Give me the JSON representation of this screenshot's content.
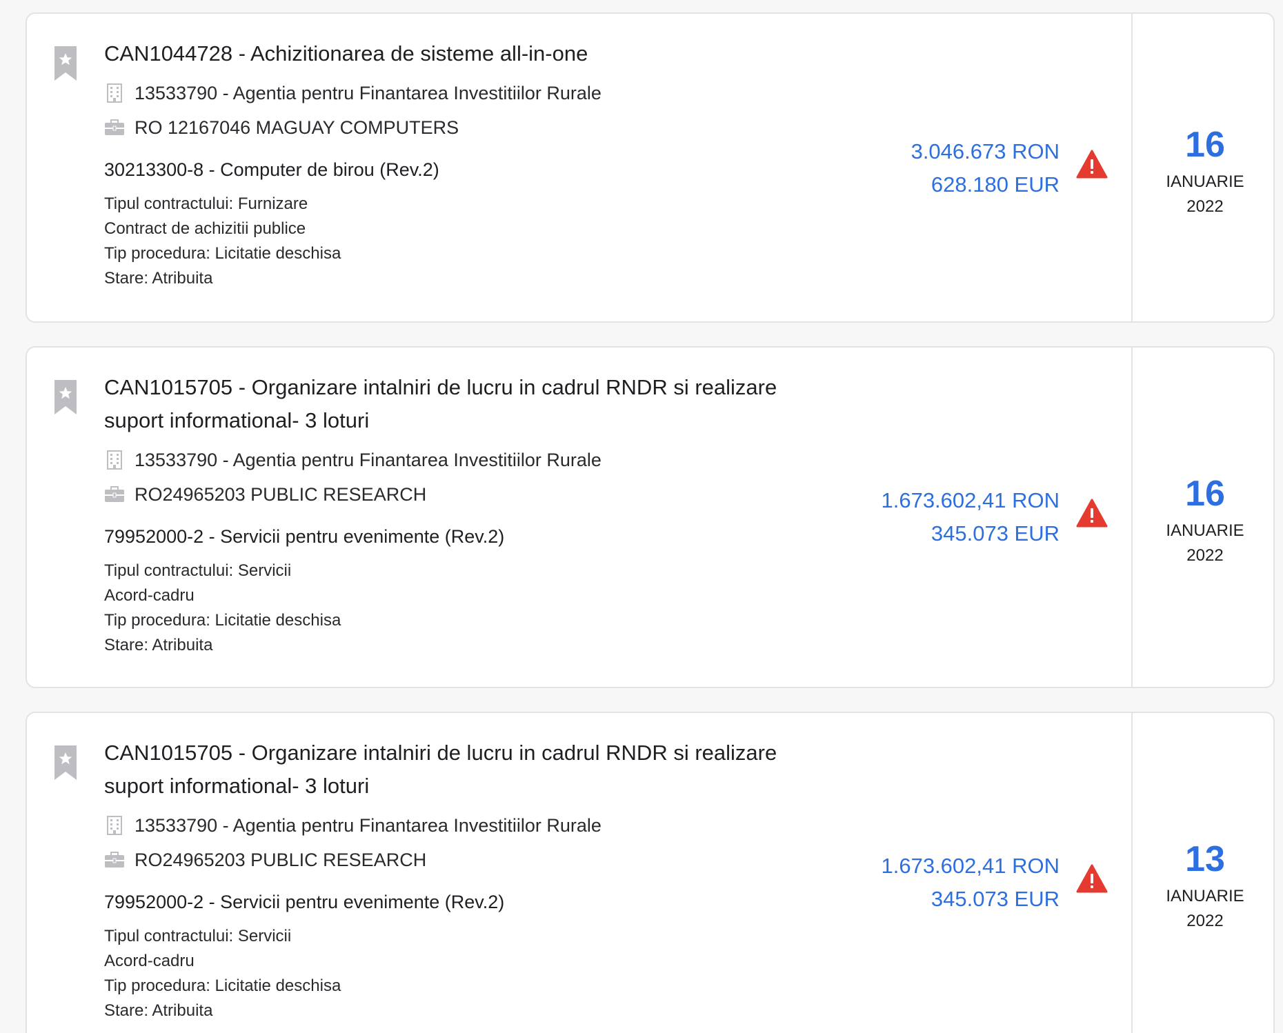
{
  "colors": {
    "accent": "#2e6fe0",
    "warning": "#e53a2f",
    "icon_gray": "#bdbdc2",
    "border": "#e3e3e6"
  },
  "cards": [
    {
      "title": "CAN1044728 - Achizitionarea de sisteme all-in-one",
      "authority": "13533790 - Agentia pentru Finantarea Investitiilor Rurale",
      "supplier": "RO 12167046 MAGUAY COMPUTERS",
      "cpv": "30213300-8 - Computer de birou (Rev.2)",
      "contract_type": "Tipul contractului: Furnizare",
      "contract_kind": "Contract de achizitii publice",
      "procedure": "Tip procedura: Licitatie deschisa",
      "status_label": "Stare: ",
      "status_value": "Atribuita",
      "value_ron": "3.046.673 RON",
      "value_eur": "628.180 EUR",
      "day": "16",
      "month": "IANUARIE",
      "year": "2022",
      "icons": [
        "bookmark-star-icon",
        "building-icon",
        "briefcase-icon",
        "warning-icon"
      ]
    },
    {
      "title": "CAN1015705 - Organizare intalniri de lucru in cadrul RNDR si realizare suport informational- 3 loturi",
      "authority": "13533790 - Agentia pentru Finantarea Investitiilor Rurale",
      "supplier": "RO24965203 PUBLIC RESEARCH",
      "cpv": "79952000-2 - Servicii pentru evenimente (Rev.2)",
      "contract_type": "Tipul contractului: Servicii",
      "contract_kind": "Acord-cadru",
      "procedure": "Tip procedura: Licitatie deschisa",
      "status_label": "Stare: ",
      "status_value": "Atribuita",
      "value_ron": "1.673.602,41 RON",
      "value_eur": "345.073 EUR",
      "day": "16",
      "month": "IANUARIE",
      "year": "2022",
      "icons": [
        "bookmark-star-icon",
        "building-icon",
        "briefcase-icon",
        "warning-icon"
      ]
    },
    {
      "title": "CAN1015705 - Organizare intalniri de lucru in cadrul RNDR si realizare suport informational- 3 loturi",
      "authority": "13533790 - Agentia pentru Finantarea Investitiilor Rurale",
      "supplier": "RO24965203 PUBLIC RESEARCH",
      "cpv": "79952000-2 - Servicii pentru evenimente (Rev.2)",
      "contract_type": "Tipul contractului: Servicii",
      "contract_kind": "Acord-cadru",
      "procedure": "Tip procedura: Licitatie deschisa",
      "status_label": "Stare: ",
      "status_value": "Atribuita",
      "value_ron": "1.673.602,41 RON",
      "value_eur": "345.073 EUR",
      "day": "13",
      "month": "IANUARIE",
      "year": "2022",
      "icons": [
        "bookmark-star-icon",
        "building-icon",
        "briefcase-icon",
        "warning-icon"
      ]
    }
  ]
}
